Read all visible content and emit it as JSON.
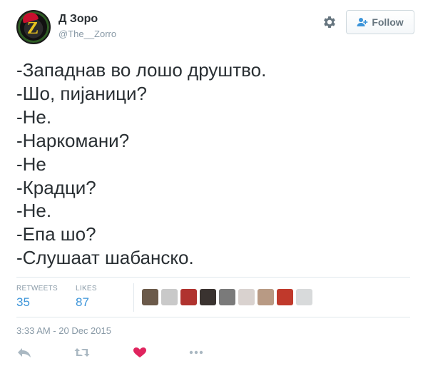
{
  "user": {
    "display_name": "Д Зоро",
    "handle": "@The__Zorro"
  },
  "follow_button": {
    "label": "Follow"
  },
  "tweet": {
    "lines": [
      "-Западнав во лошо друштво.",
      "-Шо, пијаници?",
      "-Не.",
      "-Наркомани?",
      "-Не",
      "-Крадци?",
      "-Не.",
      "-Епа шо?",
      "-Слушаат шабанско."
    ],
    "timestamp": "3:33 AM - 20 Dec 2015"
  },
  "stats": {
    "retweets_label": "RETWEETS",
    "retweets_value": "35",
    "likes_label": "LIKES",
    "likes_value": "87"
  },
  "likers": [
    {
      "icon": "liker-avatar-1",
      "color": "#6b5a4a"
    },
    {
      "icon": "liker-avatar-2",
      "color": "#c9c9c9"
    },
    {
      "icon": "liker-avatar-3",
      "color": "#b0332f"
    },
    {
      "icon": "liker-avatar-4",
      "color": "#3a3330"
    },
    {
      "icon": "liker-avatar-5",
      "color": "#7a7a7a"
    },
    {
      "icon": "liker-avatar-6",
      "color": "#d9d2cf"
    },
    {
      "icon": "liker-avatar-7",
      "color": "#b89a84"
    },
    {
      "icon": "liker-avatar-8",
      "color": "#c0392b"
    },
    {
      "icon": "liker-avatar-9",
      "color": "#d8dadb"
    }
  ],
  "actions": [
    "reply-icon",
    "retweet-icon",
    "like-icon",
    "more-icon"
  ],
  "colors": {
    "link_blue": "#3b94d9",
    "muted": "#8899a6",
    "like_red": "#e0245e",
    "text": "#292f33"
  }
}
